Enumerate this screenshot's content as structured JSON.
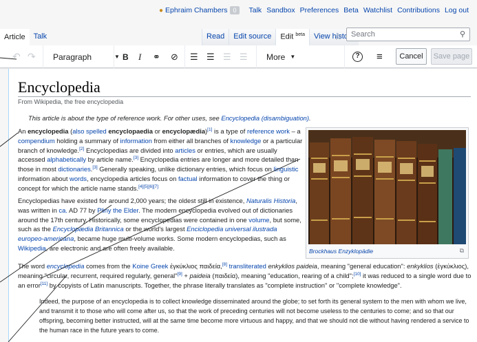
{
  "personal": {
    "user": "Ephraim Chambers",
    "notifications": "0",
    "links": [
      "Talk",
      "Sandbox",
      "Preferences",
      "Beta",
      "Watchlist",
      "Contributions",
      "Log out"
    ]
  },
  "tabs": {
    "left": [
      "Article",
      "Talk"
    ],
    "right": [
      "Read",
      "Edit source",
      "Edit",
      "View history"
    ],
    "edit_badge": "beta"
  },
  "search": {
    "placeholder": "Search"
  },
  "toolbar": {
    "paragraph_label": "Paragraph",
    "more_label": "More",
    "cancel_label": "Cancel",
    "save_label": "Save page"
  },
  "article": {
    "title": "Encyclopedia",
    "tagline": "From Wikipedia, the free encyclopedia",
    "hatnote_prefix": "This article is about the type of reference work. For other uses, see ",
    "hatnote_link": "Encyclopedia (disambiguation)",
    "hatnote_suffix": ".",
    "thumb_caption": "Brockhaus Enzyklopädie"
  },
  "colors": {
    "link": "#0645ad",
    "content_border": "#a7d7f9",
    "accent_user": "#c88a1d"
  }
}
